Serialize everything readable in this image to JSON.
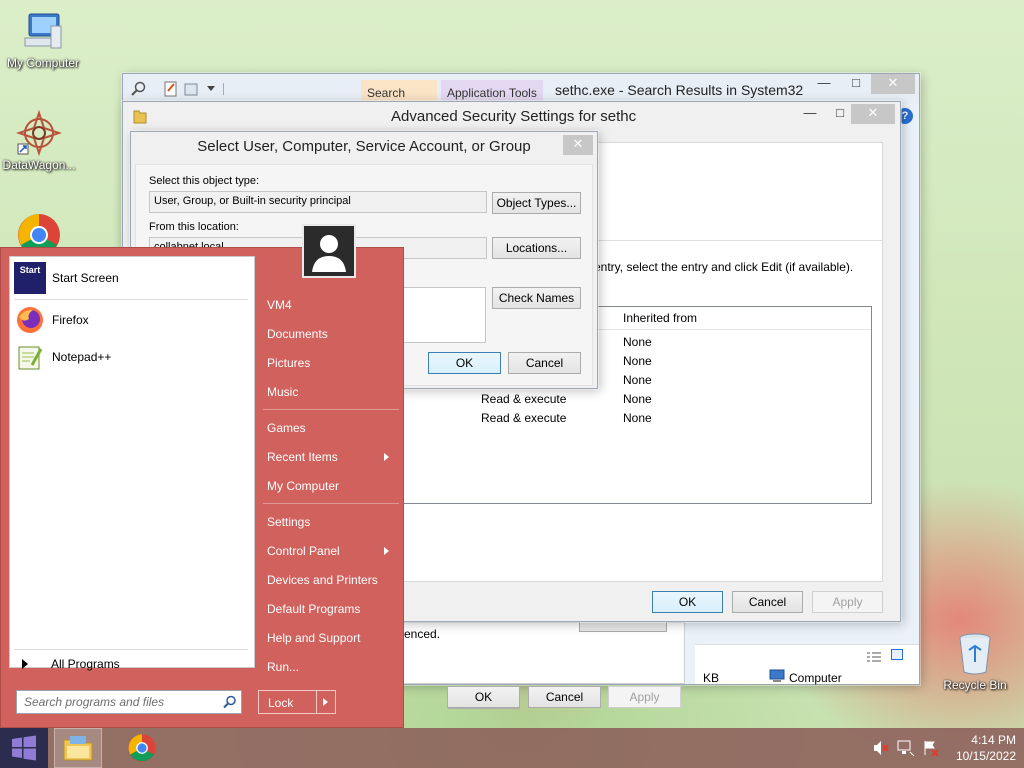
{
  "desktop": {
    "icons": [
      {
        "label": "My Computer"
      },
      {
        "label": "DataWagon..."
      },
      {
        "label": "Recycle Bin"
      }
    ]
  },
  "explorer": {
    "title": "sethc.exe - Search Results in System32",
    "context_tab_search": "Search Tools",
    "context_tab_app": "Application Tools",
    "status_size": "KB",
    "status_location": "Computer",
    "partial_text": "enced.",
    "buttons": {
      "ok": "OK",
      "cancel": "Cancel",
      "apply": "Apply"
    }
  },
  "adv_security": {
    "title": "Advanced Security Settings for sethc",
    "instruction": "entry, select the entry and click Edit (if available).",
    "column_inherited": "Inherited from",
    "rows": [
      {
        "access": "",
        "inherited": "None"
      },
      {
        "access": "",
        "inherited": "None"
      },
      {
        "access": "",
        "inherited": "None"
      },
      {
        "access": "Read & execute",
        "inherited": "None"
      },
      {
        "access": "Read & execute",
        "inherited": "None"
      }
    ],
    "buttons": {
      "ok": "OK",
      "cancel": "Cancel",
      "apply": "Apply"
    }
  },
  "select_user": {
    "title": "Select User, Computer, Service Account, or Group",
    "object_type_label": "Select this object type:",
    "object_type_value": "User, Group, or Built-in security principal",
    "object_types_button": "Object Types...",
    "location_label": "From this location:",
    "location_value": "collabnet.local",
    "locations_button": "Locations...",
    "check_names_button": "Check Names",
    "ok_button": "OK",
    "cancel_button": "Cancel"
  },
  "start_menu": {
    "programs": [
      {
        "label": "Start Screen",
        "icon": "start-screen-icon"
      },
      {
        "label": "Firefox",
        "icon": "firefox-icon"
      },
      {
        "label": "Notepad++",
        "icon": "notepadpp-icon"
      }
    ],
    "all_programs": "All Programs",
    "search_placeholder": "Search programs and files",
    "right_items": [
      {
        "label": "VM4"
      },
      {
        "label": "Documents"
      },
      {
        "label": "Pictures"
      },
      {
        "label": "Music"
      },
      {
        "label": "Games"
      },
      {
        "label": "Recent Items"
      },
      {
        "label": "My Computer"
      },
      {
        "label": "Settings"
      },
      {
        "label": "Control Panel"
      },
      {
        "label": "Devices and Printers"
      },
      {
        "label": "Default Programs"
      },
      {
        "label": "Help and Support"
      },
      {
        "label": "Run..."
      }
    ],
    "lock_label": "Lock",
    "start_tile_text": "Start"
  },
  "taskbar": {
    "time": "4:14 PM",
    "date": "10/15/2022"
  }
}
